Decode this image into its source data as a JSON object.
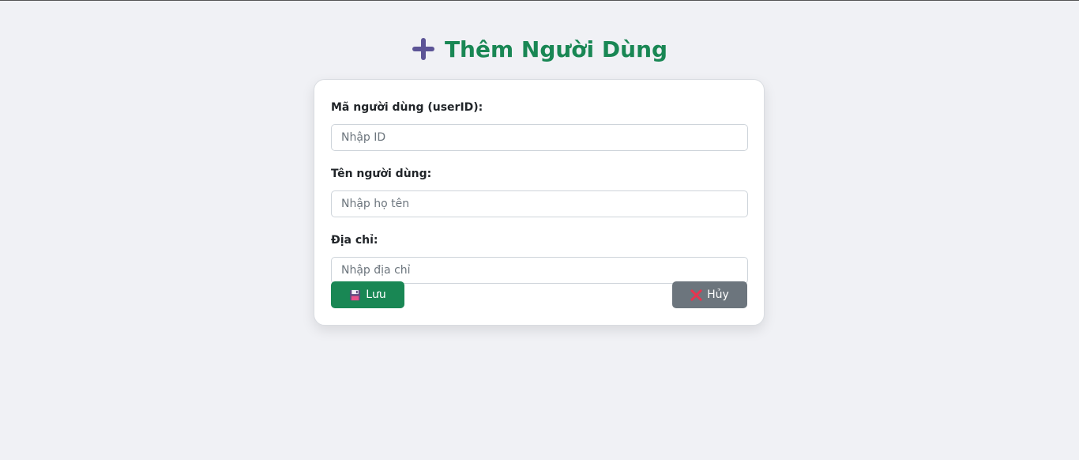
{
  "header": {
    "title": "Thêm Người Dùng",
    "icon": "plus-icon"
  },
  "form": {
    "fields": [
      {
        "label": "Mã người dùng (userID):",
        "placeholder": "Nhập ID",
        "value": ""
      },
      {
        "label": "Tên người dùng:",
        "placeholder": "Nhập họ tên",
        "value": ""
      },
      {
        "label": "Địa chỉ:",
        "placeholder": "Nhập địa chỉ",
        "value": ""
      }
    ],
    "save_label": "Lưu",
    "save_icon": "floppy-disk-icon",
    "cancel_label": "Hủy",
    "cancel_icon": "close-icon"
  },
  "colors": {
    "accent": "#198754",
    "icon_purple": "#5c5496",
    "secondary": "#6c757d",
    "danger": "#e8344f",
    "background": "#f0f1f5"
  }
}
